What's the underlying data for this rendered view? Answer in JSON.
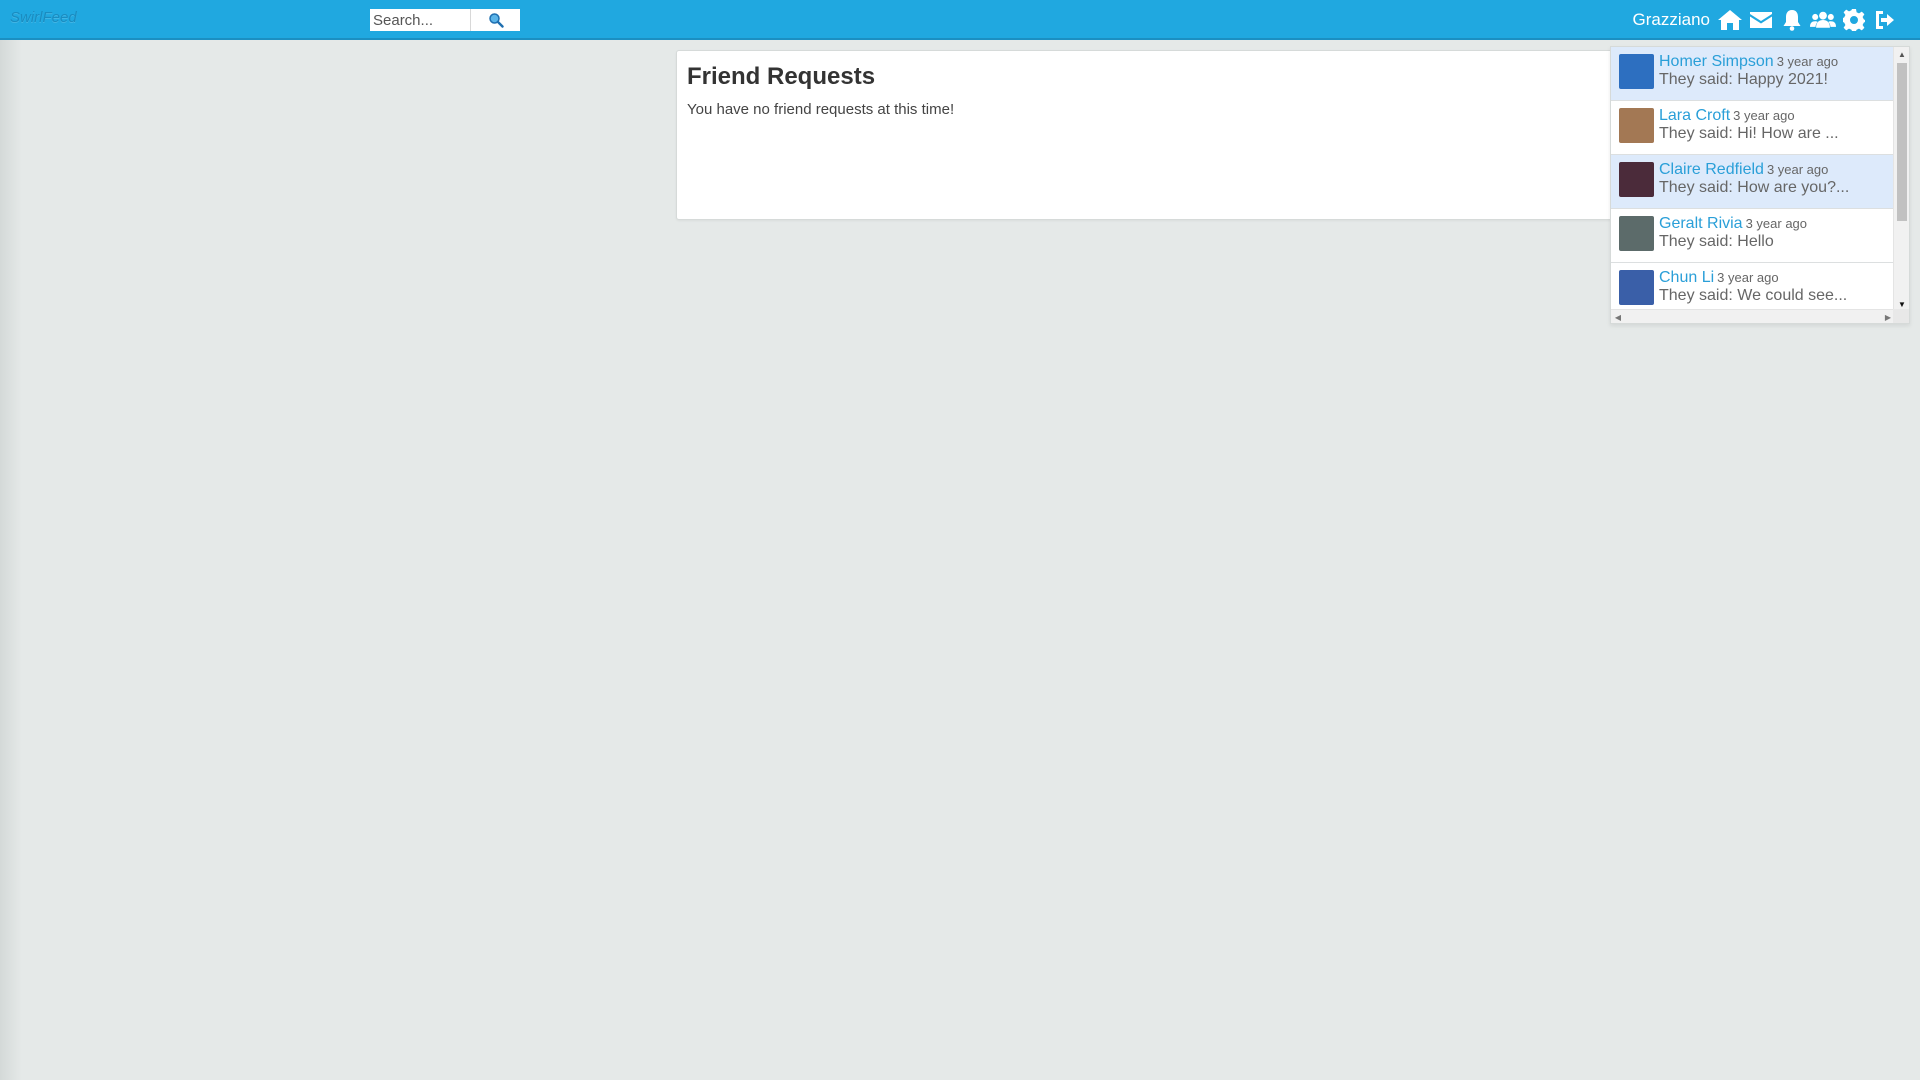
{
  "app": {
    "logo": "SwirlFeed",
    "search_placeholder": "Search...",
    "user_name": "Grazziano"
  },
  "nav_icons": [
    "home-icon",
    "envelope-icon",
    "bell-icon",
    "users-icon",
    "gear-icon",
    "sign-out-icon"
  ],
  "panel": {
    "title": "Friend Requests",
    "message": "You have no friend requests at this time!"
  },
  "messages": [
    {
      "sender": "Homer Simpson",
      "time": "3 year ago",
      "preview": "They said: Happy 2021!",
      "unread": true,
      "avatar_color": "#2d6fc0"
    },
    {
      "sender": "Lara Croft",
      "time": "3 year ago",
      "preview": "They said: Hi! How are ...",
      "unread": false,
      "avatar_color": "#a37854"
    },
    {
      "sender": "Claire Redfield",
      "time": "3 year ago",
      "preview": "They said: How are you?...",
      "unread": true,
      "avatar_color": "#4b2b3a"
    },
    {
      "sender": "Geralt Rivia",
      "time": "3 year ago",
      "preview": "They said: Hello",
      "unread": false,
      "avatar_color": "#5c6b6a"
    },
    {
      "sender": "Chun Li",
      "time": "3 year ago",
      "preview": "They said: We could see...",
      "unread": false,
      "avatar_color": "#3a5fa8"
    }
  ],
  "colors": {
    "topbar": "#20a8e0",
    "link": "#2a9fd8",
    "unread_bg": "#ddeafb",
    "page_bg": "#e5e9e8"
  }
}
